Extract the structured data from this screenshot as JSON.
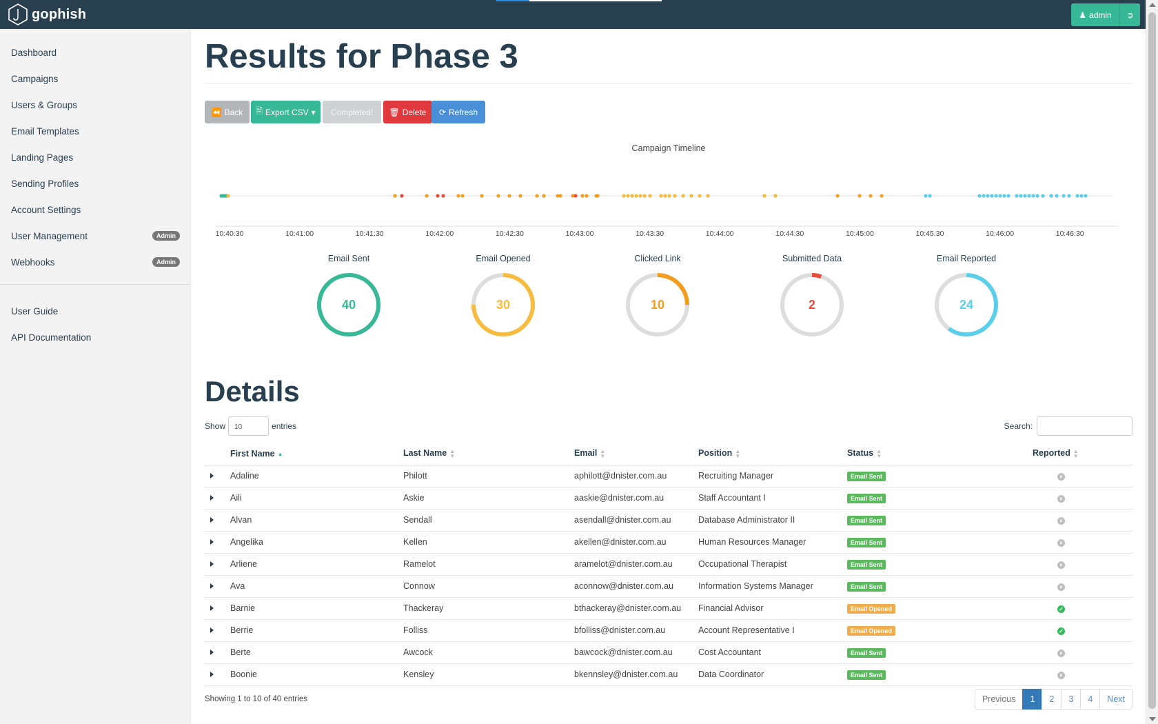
{
  "app": {
    "brand": "gophish"
  },
  "navbar": {
    "user_label": "admin"
  },
  "sidebar": {
    "items": [
      {
        "label": "Dashboard",
        "badge": ""
      },
      {
        "label": "Campaigns",
        "badge": ""
      },
      {
        "label": "Users & Groups",
        "badge": ""
      },
      {
        "label": "Email Templates",
        "badge": ""
      },
      {
        "label": "Landing Pages",
        "badge": ""
      },
      {
        "label": "Sending Profiles",
        "badge": ""
      },
      {
        "label": "Account Settings",
        "badge": ""
      },
      {
        "label": "User Management",
        "badge": "Admin"
      },
      {
        "label": "Webhooks",
        "badge": "Admin"
      }
    ],
    "secondary": [
      {
        "label": "User Guide"
      },
      {
        "label": "API Documentation"
      }
    ]
  },
  "page": {
    "title": "Results for Phase 3"
  },
  "toolbar": {
    "back": "Back",
    "export": "Export CSV",
    "completed": "Completed!",
    "delete": "Delete",
    "refresh": "Refresh"
  },
  "timeline": {
    "title": "Campaign Timeline",
    "ticks": [
      "10:40:30",
      "10:41:00",
      "10:41:30",
      "10:42:00",
      "10:42:30",
      "10:43:00",
      "10:43:30",
      "10:44:00",
      "10:44:30",
      "10:45:00",
      "10:45:30",
      "10:46:00",
      "10:46:30"
    ]
  },
  "stats": [
    {
      "label": "Email Sent",
      "value": "40",
      "total": 40,
      "count": 40,
      "color": "#37b897"
    },
    {
      "label": "Email Opened",
      "value": "30",
      "total": 40,
      "count": 30,
      "color": "#f5bc3f"
    },
    {
      "label": "Clicked Link",
      "value": "10",
      "total": 40,
      "count": 10,
      "color": "#f39c20"
    },
    {
      "label": "Submitted Data",
      "value": "2",
      "total": 40,
      "count": 2,
      "color": "#e74c3c"
    },
    {
      "label": "Email Reported",
      "value": "24",
      "total": 40,
      "count": 24,
      "color": "#5bcfe9"
    }
  ],
  "details": {
    "title": "Details",
    "show_label": "Show",
    "entries_value": "10",
    "entries_label": "entries",
    "search_label": "Search:",
    "columns": [
      "First Name",
      "Last Name",
      "Email",
      "Position",
      "Status",
      "Reported"
    ],
    "rows": [
      {
        "first": "Adaline",
        "last": "Philott",
        "email": "aphilott@dnister.com.au",
        "position": "Recruiting Manager",
        "status": "Email Sent",
        "reported": false
      },
      {
        "first": "Aili",
        "last": "Askie",
        "email": "aaskie@dnister.com.au",
        "position": "Staff Accountant I",
        "status": "Email Sent",
        "reported": false
      },
      {
        "first": "Alvan",
        "last": "Sendall",
        "email": "asendall@dnister.com.au",
        "position": "Database Administrator II",
        "status": "Email Sent",
        "reported": false
      },
      {
        "first": "Angelika",
        "last": "Kellen",
        "email": "akellen@dnister.com.au",
        "position": "Human Resources Manager",
        "status": "Email Sent",
        "reported": false
      },
      {
        "first": "Arliene",
        "last": "Ramelot",
        "email": "aramelot@dnister.com.au",
        "position": "Occupational Therapist",
        "status": "Email Sent",
        "reported": false
      },
      {
        "first": "Ava",
        "last": "Connow",
        "email": "aconnow@dnister.com.au",
        "position": "Information Systems Manager",
        "status": "Email Sent",
        "reported": false
      },
      {
        "first": "Barnie",
        "last": "Thackeray",
        "email": "bthackeray@dnister.com.au",
        "position": "Financial Advisor",
        "status": "Email Opened",
        "reported": true
      },
      {
        "first": "Berrie",
        "last": "Folliss",
        "email": "bfolliss@dnister.com.au",
        "position": "Account Representative I",
        "status": "Email Opened",
        "reported": true
      },
      {
        "first": "Berte",
        "last": "Awcock",
        "email": "bawcock@dnister.com.au",
        "position": "Cost Accountant",
        "status": "Email Sent",
        "reported": false
      },
      {
        "first": "Boonie",
        "last": "Kensley",
        "email": "bkennsley@dnister.com.au",
        "position": "Data Coordinator",
        "status": "Email Sent",
        "reported": false
      }
    ],
    "showing": "Showing 1 to 10 of 40 entries",
    "pagination": {
      "previous": "Previous",
      "pages": [
        "1",
        "2",
        "3",
        "4"
      ],
      "next": "Next",
      "active": "1"
    }
  }
}
